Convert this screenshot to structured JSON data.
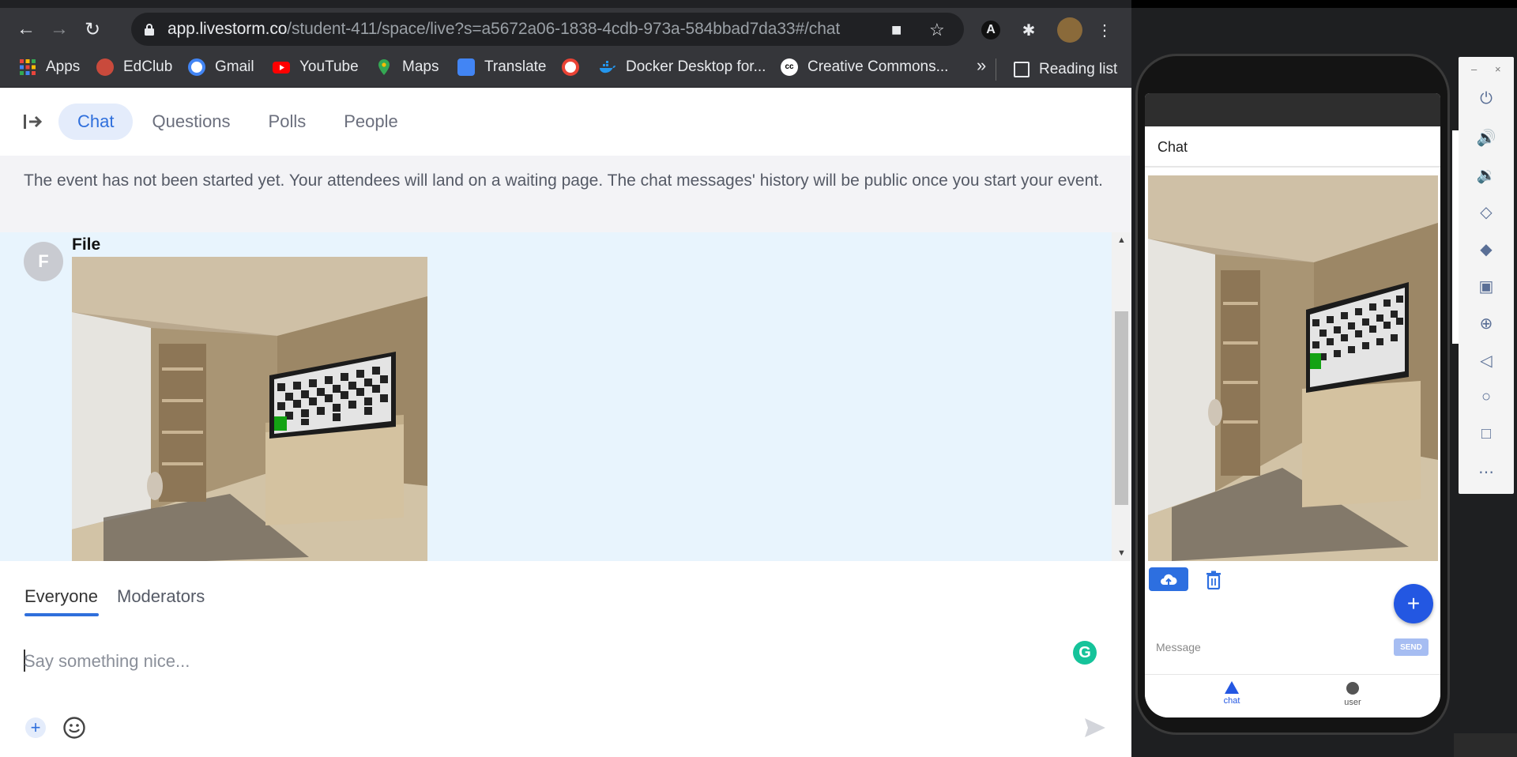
{
  "browser": {
    "url_host": "app.livestorm.co",
    "url_path": "/student-411/space/live?s=a5672a06-1838-4cdb-973a-584bbad7da33#/chat",
    "bookmarks": [
      {
        "label": "Apps",
        "icon": "apps-grid-icon",
        "color": "#e8453c"
      },
      {
        "label": "EdClub",
        "icon": "edclub-icon",
        "color": "#d9534f"
      },
      {
        "label": "Gmail",
        "icon": "google-icon",
        "color": "#4285f4"
      },
      {
        "label": "YouTube",
        "icon": "youtube-icon",
        "color": "#ff0000"
      },
      {
        "label": "Maps",
        "icon": "maps-icon",
        "color": "#34a853"
      },
      {
        "label": "Translate",
        "icon": "translate-icon",
        "color": "#4285f4"
      },
      {
        "label": "",
        "icon": "google-icon",
        "color": "#4285f4"
      },
      {
        "label": "Docker Desktop for...",
        "icon": "docker-icon",
        "color": "#2496ed"
      },
      {
        "label": "Creative Commons...",
        "icon": "cc-icon",
        "color": "#ffffff"
      }
    ],
    "more": "»",
    "reading_list": "Reading list"
  },
  "app": {
    "tabs": [
      "Chat",
      "Questions",
      "Polls",
      "People"
    ],
    "notice": "The event has not been started yet. Your attendees will land on a waiting page. The chat messages' history will be public once you start your event.",
    "message": {
      "avatar_letter": "F",
      "author": "File"
    },
    "subtabs": [
      "Everyone",
      "Moderators"
    ],
    "input_placeholder": "Say something nice..."
  },
  "mobile": {
    "title": "Chat",
    "message_placeholder": "Message",
    "send": "SEND",
    "nav": [
      {
        "label": "chat",
        "icon": "triangle-icon",
        "color": "#2357e2"
      },
      {
        "label": "user",
        "icon": "circle-icon",
        "color": "#555555"
      }
    ]
  },
  "colors": {
    "accent": "#2f6fdc",
    "chat_bg": "#e8f4fd",
    "fab": "#2357e2"
  }
}
